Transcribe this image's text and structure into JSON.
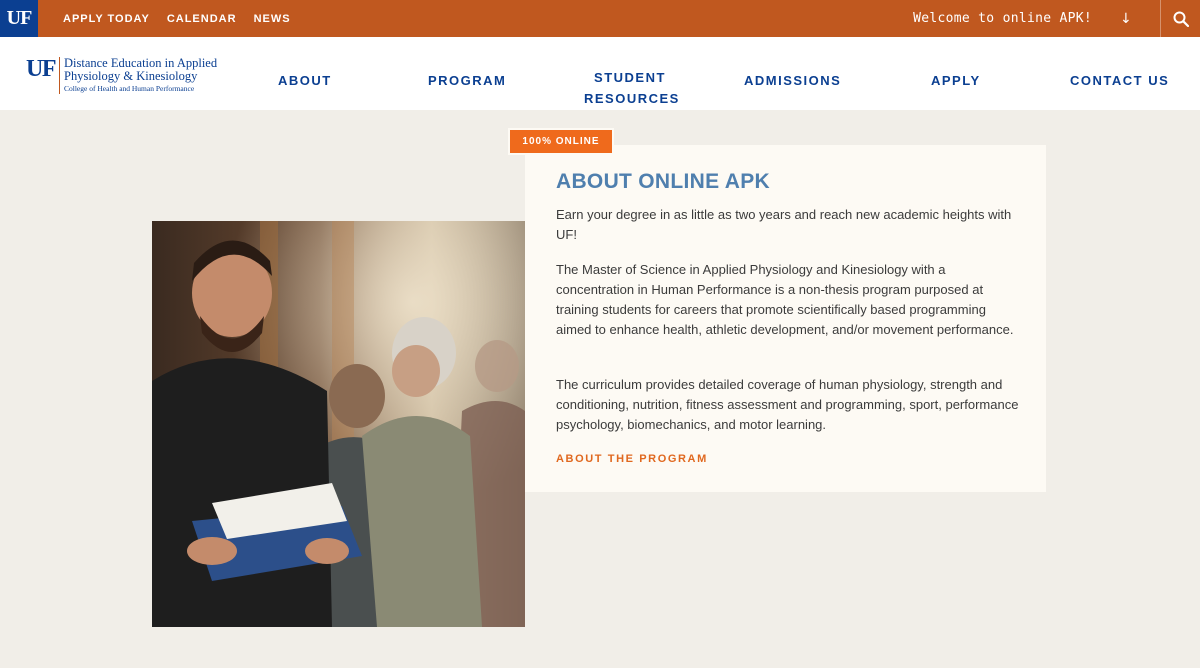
{
  "topbar": {
    "logo": "UF",
    "links": [
      "APPLY TODAY",
      "CALENDAR",
      "NEWS"
    ],
    "welcome": "Welcome to online APK!",
    "welcome_arrow": "↓",
    "colors": {
      "bar": "#c0581f",
      "logo_bg": "#0b3f91"
    }
  },
  "logo": {
    "mark": "UF",
    "line1": "Distance Education in Applied",
    "line2": "Physiology & Kinesiology",
    "line3": "College of Health and Human Performance"
  },
  "nav": {
    "items": [
      "ABOUT",
      "PROGRAM",
      "STUDENT",
      "RESOURCES",
      "ADMISSIONS",
      "APPLY",
      "CONTACT US"
    ]
  },
  "main": {
    "badge": "100% ONLINE",
    "heading": "ABOUT ONLINE APK",
    "paragraphs": [
      "Earn your degree in as little as two years and reach new academic heights with UF!",
      "The Master of Science in Applied Physiology and Kinesiology with a concentration in Human Performance is a non-thesis program purposed at training students for careers that promote scientifically based programming aimed to enhance health, athletic development, and/or movement performance.",
      "The curriculum provides detailed coverage of human physiology, strength and conditioning, nutrition, fitness assessment and programming, sport, performance psychology, biomechanics, and motor learning."
    ],
    "link": "ABOUT THE PROGRAM",
    "colors": {
      "heading": "#4f7fae",
      "accent": "#ef6a1c"
    }
  }
}
